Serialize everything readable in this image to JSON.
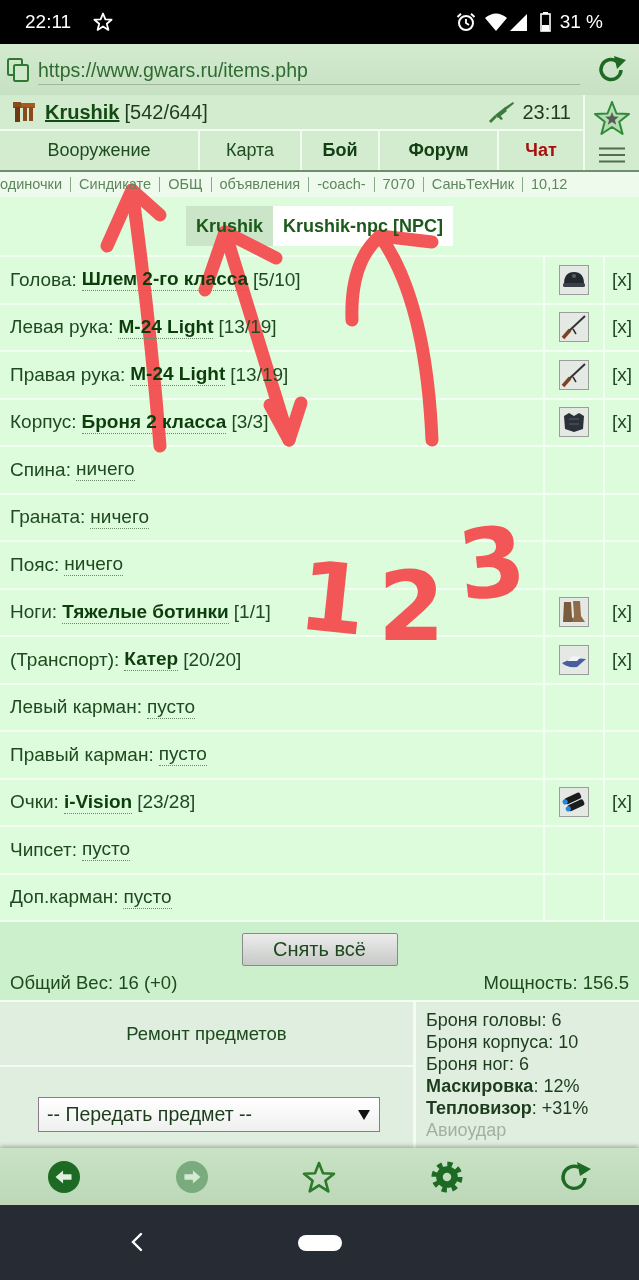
{
  "status_bar": {
    "time": "22:11",
    "battery": "31 %"
  },
  "browser": {
    "url": "https://www.gwars.ru/items.php",
    "back": {
      "disabled": false
    },
    "forward": {
      "disabled": true
    }
  },
  "header": {
    "player": "Krushik",
    "hp": "[542/644]",
    "server_time": "23:11"
  },
  "nav_tabs": [
    {
      "label": "Вооружение",
      "kind": "plain"
    },
    {
      "label": "Карта",
      "kind": "plain"
    },
    {
      "label": "Бой",
      "kind": "bold"
    },
    {
      "label": "Форум",
      "kind": "bold"
    },
    {
      "label": "Чат",
      "kind": "alert"
    }
  ],
  "quick_links": [
    "одиночки",
    "Синдикате",
    "ОБЩ",
    "объявления",
    "-coach-",
    "7070",
    "СаньТехНик",
    "10,12"
  ],
  "character_tabs": [
    {
      "label": "Krushik",
      "selected": true
    },
    {
      "label": "Krushik-npc [NPC]",
      "selected": false
    }
  ],
  "slots": [
    {
      "kind": "equipped",
      "slot": "Голова:",
      "item": "Шлем 2-го класса",
      "durability": "[5/10]",
      "remove": "[x]"
    },
    {
      "kind": "equipped",
      "slot": "Левая рука:",
      "item": "M-24 Light",
      "durability": "[13/19]",
      "remove": "[x]"
    },
    {
      "kind": "equipped",
      "slot": "Правая рука:",
      "item": "M-24 Light",
      "durability": "[13/19]",
      "remove": "[x]"
    },
    {
      "kind": "equipped",
      "slot": "Корпус:",
      "item": "Броня 2 класса",
      "durability": "[3/3]",
      "remove": "[x]"
    },
    {
      "kind": "empty",
      "slot": "Спина:",
      "value": "ничего"
    },
    {
      "kind": "empty",
      "slot": "Граната:",
      "value": "ничего"
    },
    {
      "kind": "empty",
      "slot": "Пояс:",
      "value": "ничего"
    },
    {
      "kind": "equipped",
      "slot": "Ноги:",
      "item": "Тяжелые ботинки",
      "durability": "[1/1]",
      "remove": "[x]"
    },
    {
      "kind": "equipped",
      "slot": "(Транспорт):",
      "item": "Катер",
      "durability": "[20/20]",
      "remove": "[x]"
    },
    {
      "kind": "empty",
      "slot": "Левый карман:",
      "value": "пусто"
    },
    {
      "kind": "empty",
      "slot": "Правый карман:",
      "value": "пусто"
    },
    {
      "kind": "equipped",
      "slot": "Очки:",
      "item": "i-Vision",
      "durability": "[23/28]",
      "remove": "[x]"
    },
    {
      "kind": "empty",
      "slot": "Чипсет:",
      "value": "пусто"
    },
    {
      "kind": "empty",
      "slot": "Доп.карман:",
      "value": "пусто"
    }
  ],
  "take_off_button": "Снять всё",
  "total_weight": "Общий Вес: 16 (+0)",
  "power": "Мощность: 156.5",
  "repair_link": "Ремонт предметов",
  "transfer_select": {
    "value": "-- Передать предмет --"
  },
  "stats": [
    {
      "text": "Броня головы: 6",
      "muted": false
    },
    {
      "text": "Броня корпуса: 10",
      "muted": false
    },
    {
      "text": "Броня ног: 6",
      "muted": false
    },
    {
      "text": "**Маскировка**: 12%",
      "muted": false
    },
    {
      "text": "**Тепловизор**: +31%",
      "muted": false
    },
    {
      "text": "Авиоудар",
      "muted": true
    }
  ],
  "annotations": {
    "arrows": [
      {
        "kind": "single"
      },
      {
        "kind": "double"
      },
      {
        "kind": "single"
      }
    ],
    "numbers": [
      "1",
      "2",
      "3"
    ]
  }
}
